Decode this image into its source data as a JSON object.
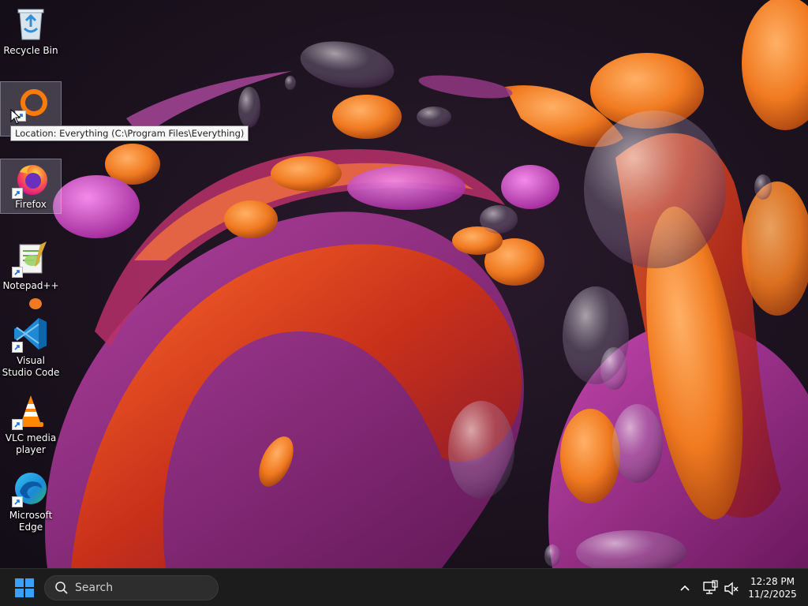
{
  "desktop": {
    "icons": [
      {
        "label": "Recycle Bin"
      },
      {
        "label": "Everything"
      },
      {
        "label": "Firefox"
      },
      {
        "label": "Notepad++"
      },
      {
        "label": "Visual Studio Code"
      },
      {
        "label": "VLC media player"
      },
      {
        "label": "Microsoft Edge"
      }
    ],
    "tooltip": "Location: Everything (C:\\Program Files\\Everything)"
  },
  "taskbar": {
    "start_icon": "windows-logo-icon",
    "search_placeholder": "Search",
    "clock_time": "12:28 PM",
    "clock_date": "11/2/2025",
    "tray_icons": [
      "chevron-up-icon",
      "network-icon",
      "volume-muted-icon"
    ]
  },
  "colors": {
    "taskbar_bg": "#1c1c1c",
    "wallpaper_bg": "#1a1320",
    "windows_blue": "#1e90ff"
  }
}
